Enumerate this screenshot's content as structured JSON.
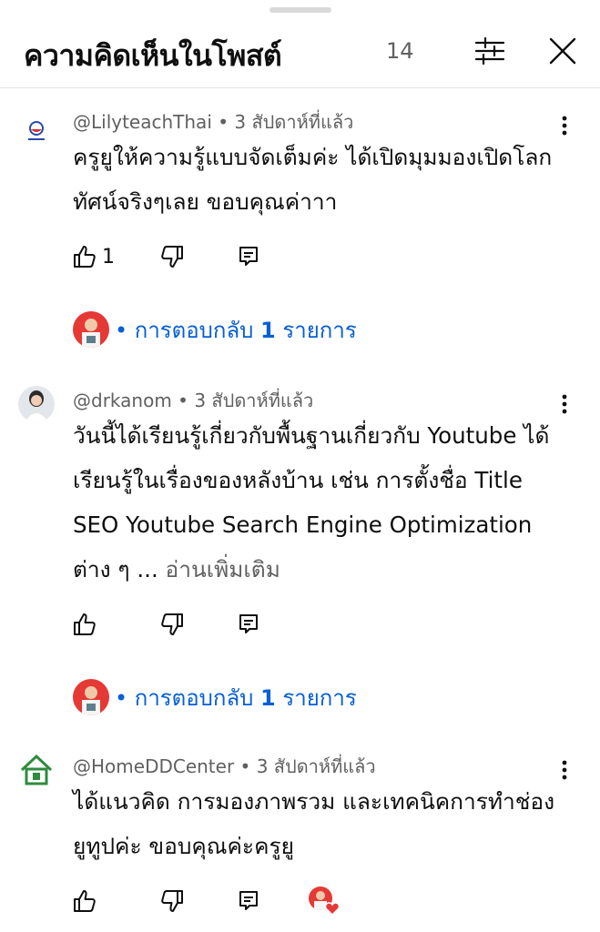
{
  "header": {
    "title": "ความคิดเห็นในโพสต์",
    "count": "14"
  },
  "comments": [
    {
      "author": "@LilyteachThai",
      "time": "3 สัปดาห์ที่แล้ว",
      "text": "ครูยูให้ความรู้แบบจัดเต็มค่ะ ได้เปิดมุมมองเปิดโลกทัศน์จริงๆเลย ขอบคุณค่าาา",
      "likes": "1",
      "replies_prefix": "• การตอบกลับ",
      "replies_count": "1",
      "replies_suffix": "รายการ"
    },
    {
      "author": "@drkanom",
      "time": "3 สัปดาห์ที่แล้ว",
      "text": "วันนี้ได้เรียนรู้เกี่ยวกับพื้นฐานเกี่ยวกับ Youtube ได้เรียนรู้ในเรื่องของหลังบ้าน เช่น การตั้งชื่อ Title SEO Youtube Search Engine Optimization ต่าง ๆ ...",
      "read_more": "อ่านเพิ่มเติม",
      "replies_prefix": "• การตอบกลับ",
      "replies_count": "1",
      "replies_suffix": "รายการ"
    },
    {
      "author": "@HomeDDCenter",
      "time": "3 สัปดาห์ที่แล้ว",
      "text": "ได้แนวคิด การมองภาพรวม และเทคนิคการทำช่องยูทูปค่ะ ขอบคุณค่ะครูยู"
    }
  ],
  "colors": {
    "link": "#065fd4",
    "meta": "#606060",
    "text": "#0f0f0f"
  },
  "icons": [
    "filter-icon",
    "close-icon",
    "more-vert-icon",
    "thumb-up-icon",
    "thumb-down-icon",
    "reply-icon",
    "heart-icon"
  ]
}
